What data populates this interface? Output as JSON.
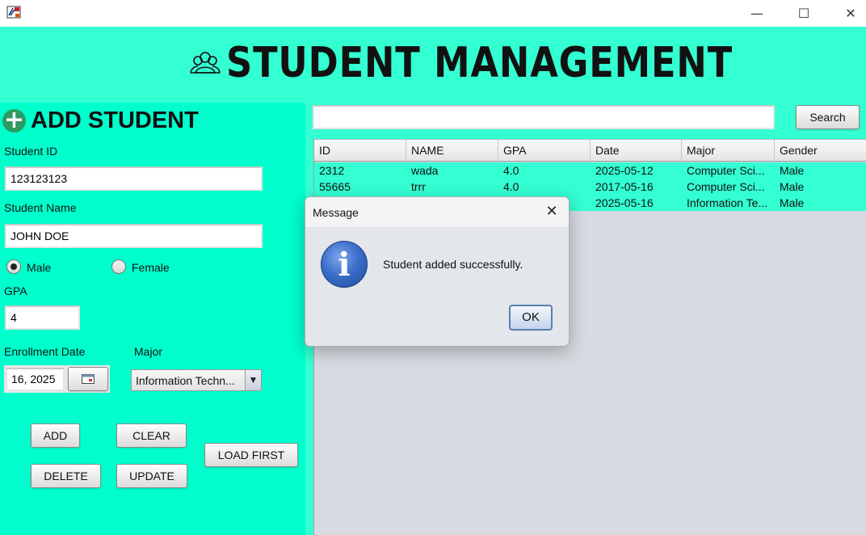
{
  "window": {
    "app_icon": "java-app-icon",
    "controls": {
      "minimize": "—",
      "maximize": "☐",
      "close": "✕"
    }
  },
  "header": {
    "title": "STUDENT MANAGEMENT",
    "icon": "students-group-icon"
  },
  "form": {
    "title": "ADD STUDENT",
    "title_icon": "plus-circle-icon",
    "student_id_label": "Student ID",
    "student_id_value": "123123123",
    "student_name_label": "Student Name",
    "student_name_value": "JOHN DOE",
    "gender_male_label": "Male",
    "gender_female_label": "Female",
    "gender_selected": "Male",
    "gpa_label": "GPA",
    "gpa_value": "4",
    "enrollment_label": "Enrollment Date",
    "enrollment_value": "16, 2025",
    "major_label": "Major",
    "major_value": "Information Techn...",
    "buttons": {
      "add": "ADD",
      "clear": "CLEAR",
      "delete": "DELETE",
      "update": "UPDATE",
      "load_first": "LOAD FIRST"
    }
  },
  "search": {
    "value": "",
    "button": "Search"
  },
  "table": {
    "columns": [
      "ID",
      "NAME",
      "GPA",
      "Date",
      "Major",
      "Gender"
    ],
    "rows": [
      [
        "2312",
        "wada",
        "4.0",
        "2025-05-12",
        "Computer Sci...",
        "Male"
      ],
      [
        "55665",
        "trrr",
        "4.0",
        "2017-05-16",
        "Computer Sci...",
        "Male"
      ],
      [
        "",
        "",
        "",
        "2025-05-16",
        "Information Te...",
        "Male"
      ]
    ]
  },
  "dialog": {
    "title": "Message",
    "close": "✕",
    "icon": "information-icon",
    "icon_glyph": "i",
    "message": "Student added successfully.",
    "ok": "OK"
  },
  "colors": {
    "header_bg": "#33ffd2",
    "form_bg": "#00ffcc",
    "table_bg": "#d7dbe1",
    "dialog_bg": "#e3e6eb"
  }
}
